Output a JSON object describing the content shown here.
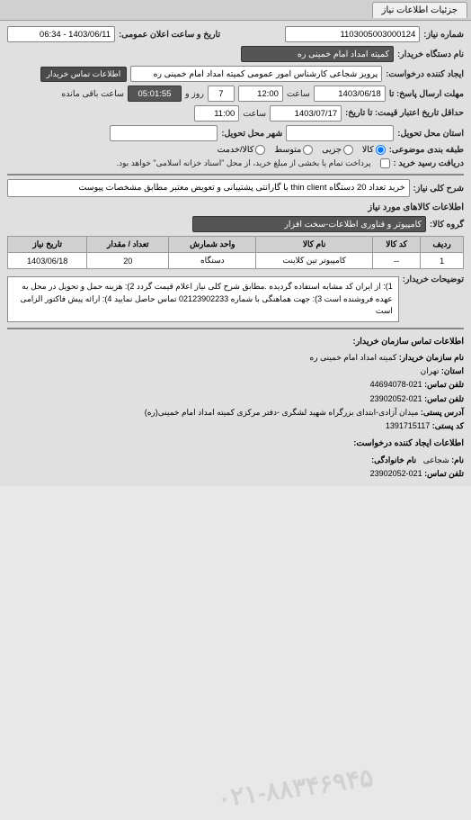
{
  "tab": {
    "label": "جزئیات اطلاعات نیاز"
  },
  "header": {
    "reqno_label": "شماره نیاز:",
    "reqno": "1103005003000124",
    "datetime_label": "تاریخ و ساعت اعلان عمومی:",
    "datetime": "1403/06/11 - 06:34",
    "buyer_label": "نام دستگاه خریدار:",
    "buyer": "کمیته امداد امام خمینی ره",
    "creator_label": "ایجاد کننده درخواست:",
    "creator": "پرویز شجاعی کارشناس امور عمومی کمیته امداد امام خمینی ره",
    "contact_btn": "اطلاعات تماس خریدار",
    "deadline_reply_label": "مهلت ارسال پاسخ: تا",
    "deadline_reply_date": "1403/06/18",
    "deadline_reply_hour_label": "ساعت",
    "deadline_reply_hour": "12:00",
    "days_label": "روز و",
    "days": "7",
    "remain_label": "ساعت باقی مانده",
    "remain": "05:01:55",
    "price_deadline_label": "حداقل تاریخ اعتبار\nقیمت: تا تاریخ:",
    "price_deadline_date": "1403/07/17",
    "price_deadline_hour_label": "ساعت",
    "price_deadline_hour": "11:00",
    "delivery_place_label": "استان محل تحویل:",
    "delivery_city_label": "شهر محل تحویل:",
    "category_label": "طبقه بندی موضوعی:",
    "radios": [
      {
        "label": "کالا",
        "checked": true
      },
      {
        "label": "جزیی",
        "checked": false
      },
      {
        "label": "متوسط",
        "checked": false
      },
      {
        "label": "کالا/خدمت",
        "checked": false
      }
    ],
    "receipt_label": "دریافت رسید خرید :",
    "receipt_text": "پرداخت تمام یا بخشی از مبلغ خرید، از محل \"اسناد خزانه اسلامی\" خواهد بود.",
    "title_label": "شرح کلی نیاز:",
    "title": "خرید تعداد 20 دستگاه thin client با گارانتی پشتیبانی و تعویض معتبر مطابق مشخصات پیوست"
  },
  "goods": {
    "section": "اطلاعات کالاهای مورد نیاز",
    "group_label": "گروه کالا:",
    "group": "کامپیوتر و فناوری اطلاعات-سخت افزار",
    "columns": [
      "ردیف",
      "کد کالا",
      "نام کالا",
      "واحد شمارش",
      "تعداد / مقدار",
      "تاریخ نیاز"
    ],
    "rows": [
      {
        "idx": "1",
        "code": "--",
        "name": "کامپیوتر تین کلاینت",
        "unit": "دستگاه",
        "qty": "20",
        "date": "1403/06/18"
      }
    ]
  },
  "notes": {
    "label": "توضیحات خریدار:",
    "text": "1): از ایران کد مشابه استفاده گردیده .مطابق شرح کلی نیاز اعلام قیمت گردد 2): هزینه حمل و تحویل در محل به عهده فروشنده است 3): جهت هماهنگی با شماره 02123902233 تماس حاصل نمایید 4): ارائه پیش فاکتور الزامی است"
  },
  "contact": {
    "header": "اطلاعات تماس سازمان خریدار:",
    "org_k": "نام سازمان خریدار:",
    "org_v": "کمیته امداد امام خمینی ره",
    "prov_k": "استان:",
    "prov_v": "تهران",
    "tel_k": "تلفن تماس:",
    "tel_v": "021-44694078",
    "fax_k": "تلفن تماس:",
    "fax_v": "021-23902052",
    "addr_k": "آدرس پستی:",
    "addr_v": "میدان آزادی-ابتدای بزرگراه شهید لشگری -دفتر مرکزی کمیته امداد امام خمینی(ره)",
    "zip_k": "کد پستی:",
    "zip_v": "1391715117",
    "sec2": "اطلاعات ایجاد کننده درخواست:",
    "name_k": "نام:",
    "name_v": "شجاعی",
    "fam_k": "نام خانوادگی:",
    "fam_v": "",
    "tel2_k": "تلفن تماس:",
    "tel2_v": "021-23902052",
    "watermark": "۰۲۱-۸۸۳۴۶۹۴۵"
  }
}
